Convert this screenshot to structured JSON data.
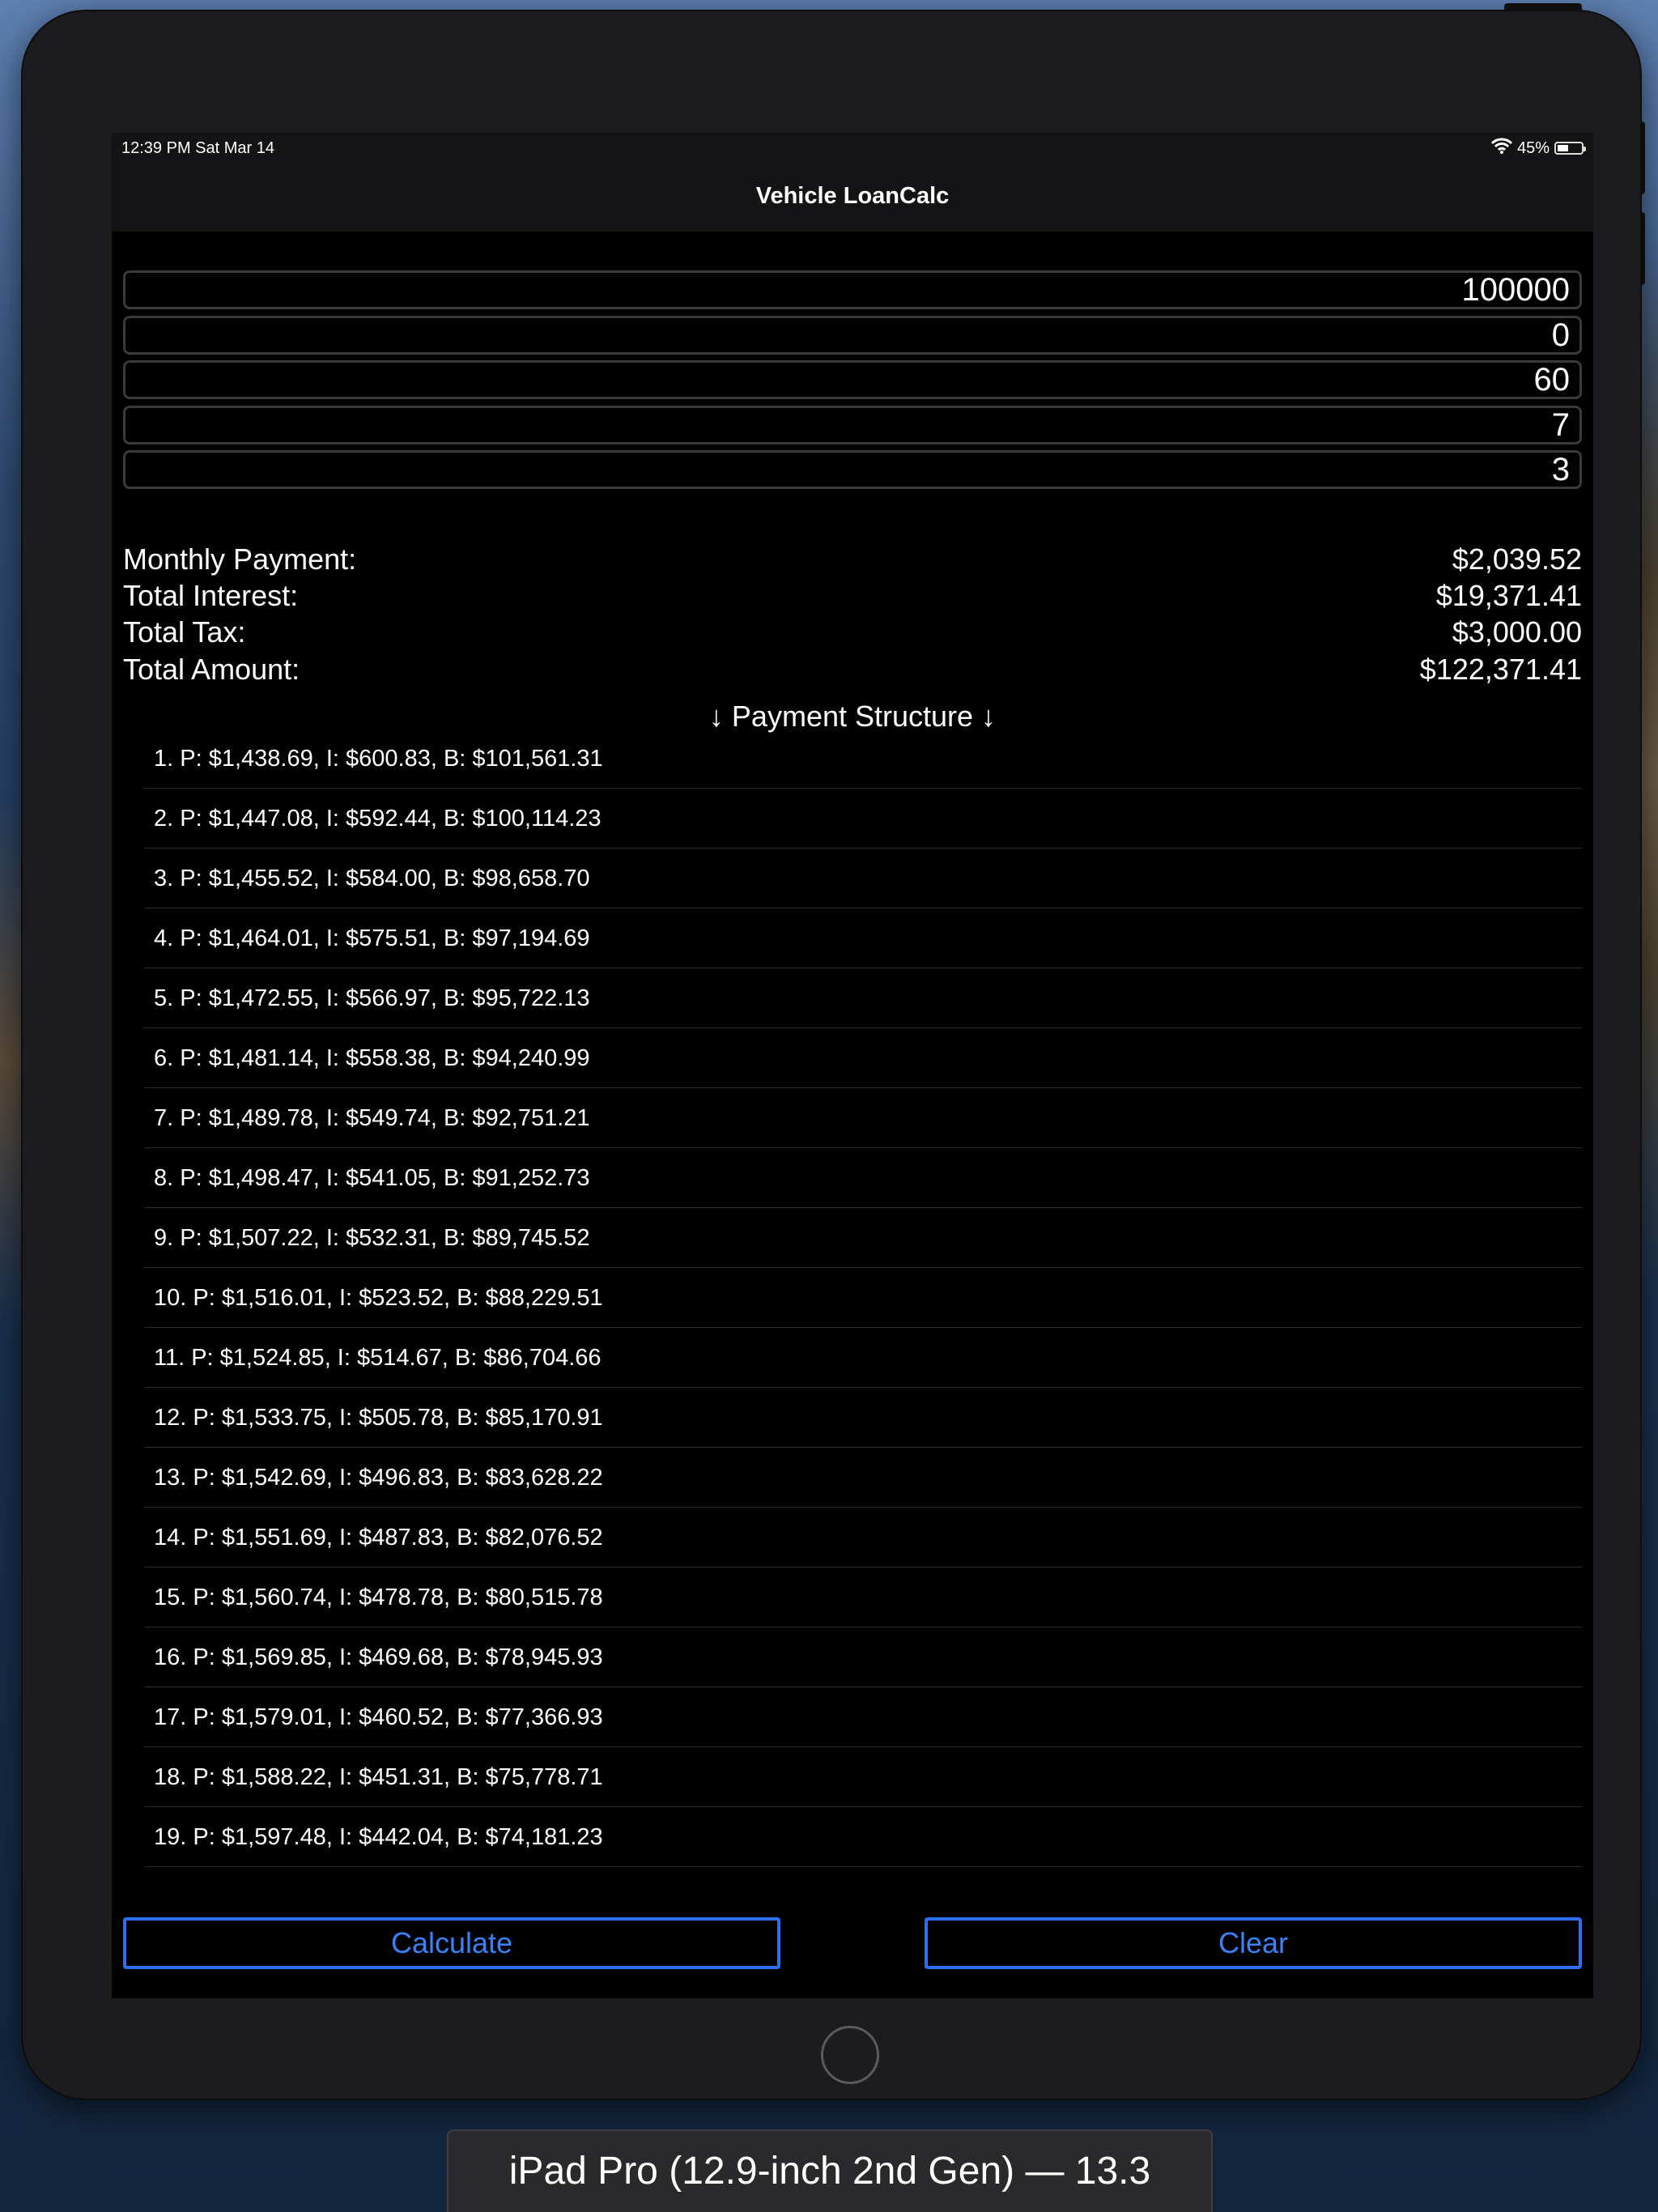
{
  "status_bar": {
    "time_date": "12:39 PM   Sat Mar 14",
    "battery_percent": "45%",
    "battery_level": 0.45
  },
  "nav": {
    "title": "Vehicle LoanCalc"
  },
  "inputs": [
    "100000",
    "0",
    "60",
    "7",
    "3"
  ],
  "summary": [
    {
      "label": "Monthly Payment:",
      "value": "$2,039.52"
    },
    {
      "label": "Total Interest:",
      "value": "$19,371.41"
    },
    {
      "label": "Total Tax:",
      "value": "$3,000.00"
    },
    {
      "label": "Total Amount:",
      "value": "$122,371.41"
    }
  ],
  "payment_structure": {
    "title": "↓ Payment Structure ↓",
    "items": [
      "1. P: $1,438.69, I: $600.83, B: $101,561.31",
      "2. P: $1,447.08, I: $592.44, B: $100,114.23",
      "3. P: $1,455.52, I: $584.00, B: $98,658.70",
      "4. P: $1,464.01, I: $575.51, B: $97,194.69",
      "5. P: $1,472.55, I: $566.97, B: $95,722.13",
      "6. P: $1,481.14, I: $558.38, B: $94,240.99",
      "7. P: $1,489.78, I: $549.74, B: $92,751.21",
      "8. P: $1,498.47, I: $541.05, B: $91,252.73",
      "9. P: $1,507.22, I: $532.31, B: $89,745.52",
      "10. P: $1,516.01, I: $523.52, B: $88,229.51",
      "11. P: $1,524.85, I: $514.67, B: $86,704.66",
      "12. P: $1,533.75, I: $505.78, B: $85,170.91",
      "13. P: $1,542.69, I: $496.83, B: $83,628.22",
      "14. P: $1,551.69, I: $487.83, B: $82,076.52",
      "15. P: $1,560.74, I: $478.78, B: $80,515.78",
      "16. P: $1,569.85, I: $469.68, B: $78,945.93",
      "17. P: $1,579.01, I: $460.52, B: $77,366.93",
      "18. P: $1,588.22, I: $451.31, B: $75,778.71",
      "19. P: $1,597.48, I: $442.04, B: $74,181.23"
    ]
  },
  "buttons": {
    "calculate": "Calculate",
    "clear": "Clear"
  },
  "device_caption": "iPad Pro (12.9-inch 2nd Gen) — 13.3",
  "colors": {
    "accent": "#3a82f7",
    "background": "#000000",
    "bar": "#141416"
  }
}
